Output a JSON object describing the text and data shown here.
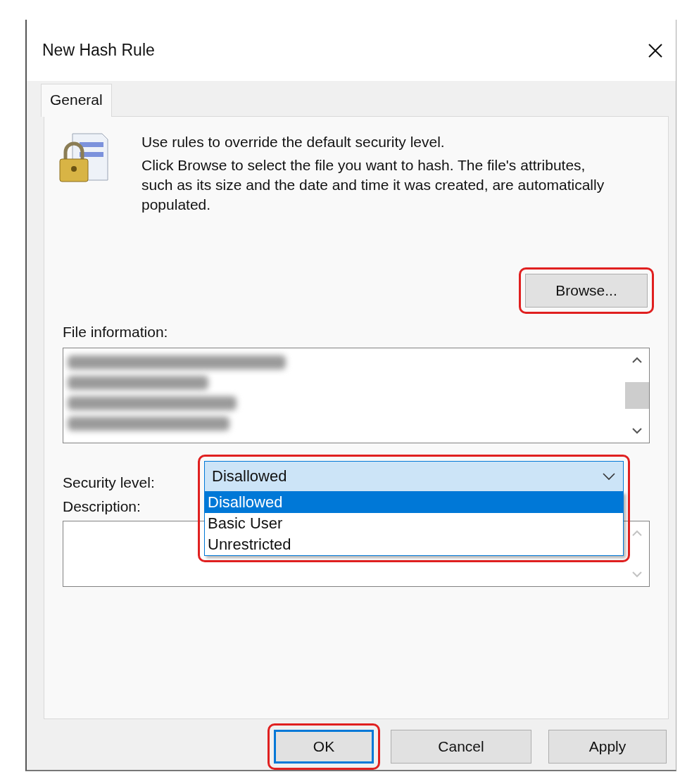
{
  "window": {
    "title": "New Hash Rule"
  },
  "tabs": [
    {
      "label": "General",
      "selected": true
    }
  ],
  "intro": [
    "Use rules to override the default security level.",
    "Click Browse to select the file you want to hash. The file's attributes, such as its size and the date and time it was created, are automatically populated."
  ],
  "browse_button": {
    "label": "Browse...",
    "highlighted": true
  },
  "file_information": {
    "label": "File information:",
    "lines": [
      {
        "kind": "redacted"
      },
      {
        "kind": "redacted"
      },
      {
        "kind": "redacted"
      },
      {
        "kind": "redacted"
      }
    ]
  },
  "security_level": {
    "label": "Security level:",
    "value": "Disallowed",
    "expanded": true,
    "highlighted": true,
    "options": [
      {
        "label": "Disallowed",
        "selected": true
      },
      {
        "label": "Basic User",
        "selected": false
      },
      {
        "label": "Unrestricted",
        "selected": false
      }
    ]
  },
  "description": {
    "label": "Description:"
  },
  "buttons": [
    {
      "label": "OK",
      "default": true,
      "highlighted": true
    },
    {
      "label": "Cancel",
      "default": false,
      "highlighted": false
    },
    {
      "label": "Apply",
      "default": false,
      "highlighted": false
    }
  ]
}
